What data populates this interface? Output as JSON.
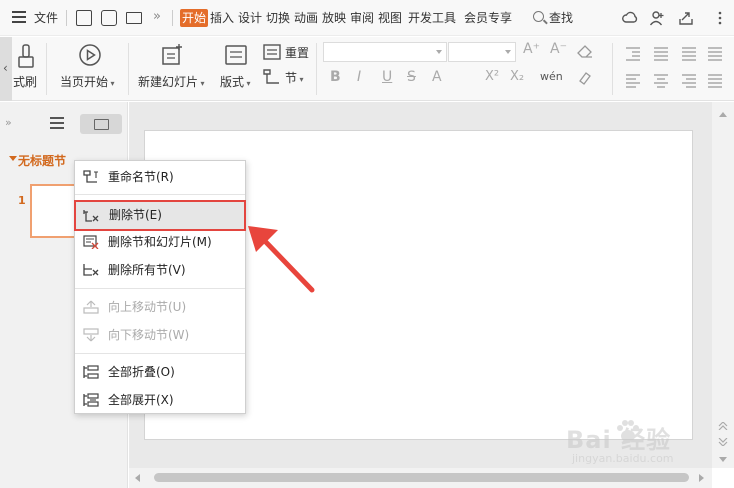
{
  "menubar": {
    "file": "文件",
    "tabs": [
      "开始",
      "插入",
      "设计",
      "切换",
      "动画",
      "放映",
      "审阅",
      "视图",
      "开发工具",
      "会员专享"
    ],
    "active_tab_index": 0,
    "search": "查找",
    "more": "»"
  },
  "ribbon": {
    "format_painter": "式刷",
    "from_current": "当页开始",
    "new_slide": "新建幻灯片",
    "layout": "版式",
    "reset": "重置",
    "section": "节",
    "fmt_bold": "B",
    "fmt_italic": "I",
    "fmt_underline": "U",
    "fmt_strike": "S",
    "fmt_fontcolor": "A",
    "fmt_super": "X²",
    "fmt_sub": "X₂",
    "fmt_phonetic": "wén",
    "fmt_grow": "A⁺",
    "fmt_shrink": "A⁻"
  },
  "left_panel": {
    "section_name": "无标题节",
    "slide_number": "1",
    "expand_glyph": "»"
  },
  "context_menu": {
    "items": [
      {
        "label": "重命名节(R)",
        "enabled": true
      },
      {
        "label": "删除节(E)",
        "enabled": true,
        "highlighted": true
      },
      {
        "label": "删除节和幻灯片(M)",
        "enabled": true
      },
      {
        "label": "删除所有节(V)",
        "enabled": true
      },
      {
        "label": "向上移动节(U)",
        "enabled": false
      },
      {
        "label": "向下移动节(W)",
        "enabled": false
      },
      {
        "label": "全部折叠(O)",
        "enabled": true
      },
      {
        "label": "全部展开(X)",
        "enabled": true
      }
    ]
  },
  "watermark": {
    "brand": "Bai  经验",
    "site": "jingyan.baidu.com"
  },
  "colors": {
    "accent": "#e46d2a",
    "highlight_border": "#e3453f",
    "annotation_arrow": "#e8453c"
  }
}
